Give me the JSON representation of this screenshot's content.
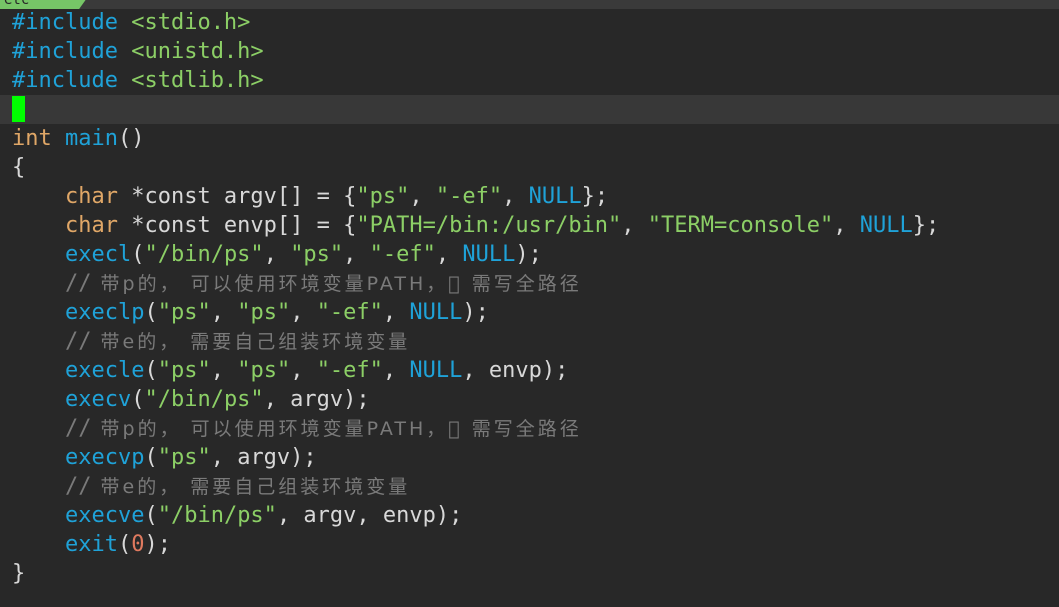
{
  "tab": {
    "label": "etc"
  },
  "code": {
    "l1": {
      "directive": "#include",
      "header": "<stdio.h>"
    },
    "l2": {
      "directive": "#include",
      "header": "<unistd.h>"
    },
    "l3": {
      "directive": "#include",
      "header": "<stdlib.h>"
    },
    "l5": {
      "type": "int",
      "name": "main",
      "parens": "()"
    },
    "l6": {
      "brace": "{"
    },
    "l7": {
      "indent": "    ",
      "type": "char",
      "rest1": " *const argv[] = {",
      "s1": "\"ps\"",
      "c1": ", ",
      "s2": "\"-ef\"",
      "c2": ", ",
      "null": "NULL",
      "end": "};"
    },
    "l8": {
      "indent": "    ",
      "type": "char",
      "rest1": " *const envp[] = {",
      "s1": "\"PATH=/bin:/usr/bin\"",
      "c1": ", ",
      "s2": "\"TERM=console\"",
      "c2": ", ",
      "null": "NULL",
      "end": "};"
    },
    "l9": {
      "indent": "    ",
      "fn": "execl",
      "open": "(",
      "s1": "\"/bin/ps\"",
      "c1": ", ",
      "s2": "\"ps\"",
      "c2": ", ",
      "s3": "\"-ef\"",
      "c3": ", ",
      "null": "NULL",
      "end": ");"
    },
    "l10": {
      "indent": "    ",
      "slash": "//",
      "text": " 带p的， 可以使用环境变量PATH，\u0000 需写全路径"
    },
    "l11": {
      "indent": "    ",
      "fn": "execlp",
      "open": "(",
      "s1": "\"ps\"",
      "c1": ", ",
      "s2": "\"ps\"",
      "c2": ", ",
      "s3": "\"-ef\"",
      "c3": ", ",
      "null": "NULL",
      "end": ");"
    },
    "l12": {
      "indent": "    ",
      "slash": "//",
      "text": " 带e的， 需要自己组装环境变量"
    },
    "l13": {
      "indent": "    ",
      "fn": "execle",
      "open": "(",
      "s1": "\"ps\"",
      "c1": ", ",
      "s2": "\"ps\"",
      "c2": ", ",
      "s3": "\"-ef\"",
      "c3": ", ",
      "null": "NULL",
      "end": ", envp);"
    },
    "l14": {
      "indent": "    ",
      "fn": "execv",
      "open": "(",
      "s1": "\"/bin/ps\"",
      "end": ", argv);"
    },
    "l15": {
      "indent": "    ",
      "slash": "//",
      "text": " 带p的， 可以使用环境变量PATH，\u0000 需写全路径"
    },
    "l16": {
      "indent": "    ",
      "fn": "execvp",
      "open": "(",
      "s1": "\"ps\"",
      "end": ", argv);"
    },
    "l17": {
      "indent": "    ",
      "slash": "//",
      "text": " 带e的， 需要自己组装环境变量"
    },
    "l18": {
      "indent": "    ",
      "fn": "execve",
      "open": "(",
      "s1": "\"/bin/ps\"",
      "end": ", argv, envp);"
    },
    "l19": {
      "indent": "    ",
      "fn": "exit",
      "open": "(",
      "num": "0",
      "end": ");"
    },
    "l20": {
      "brace": "}"
    }
  },
  "colors": {
    "background": "#282828",
    "current_line": "#383838",
    "cursor": "#00ff00",
    "preprocessor": "#1fa2d8",
    "string": "#8ccf66",
    "keyword_type": "#e0a767",
    "comment": "#7a7a7a",
    "number": "#e07a5f"
  }
}
